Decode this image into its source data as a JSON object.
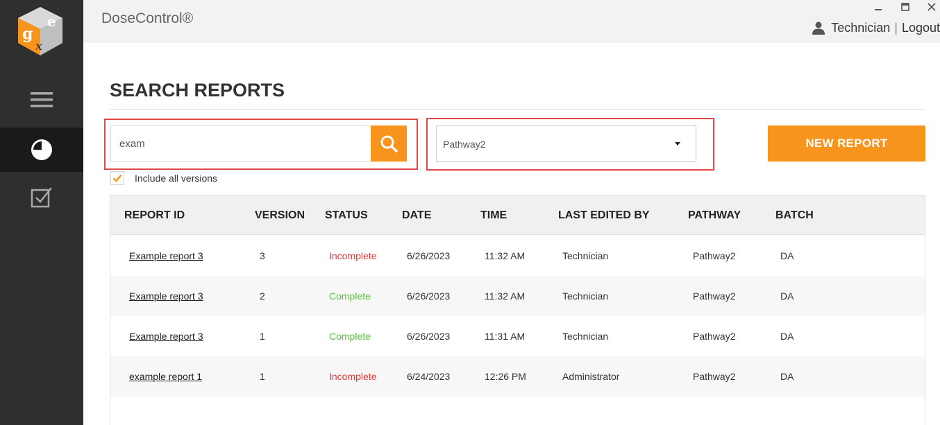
{
  "app": {
    "title": "DoseControl®"
  },
  "user": {
    "name": "Technician",
    "separator": "|",
    "logout_label": "Logout"
  },
  "page": {
    "title": "SEARCH REPORTS"
  },
  "search": {
    "value": "exam",
    "placeholder": ""
  },
  "pathway_select": {
    "selected": "Pathway2"
  },
  "new_report_label": "NEW REPORT",
  "include_versions": {
    "label": "Include all versions",
    "checked": true
  },
  "table": {
    "headers": [
      "REPORT ID",
      "VERSION",
      "STATUS",
      "DATE",
      "TIME",
      "LAST EDITED BY",
      "PATHWAY",
      "BATCH"
    ],
    "rows": [
      [
        "Example report 3",
        "3",
        "Incomplete",
        "6/26/2023",
        "11:32 AM",
        "Technician",
        "Pathway2",
        "DA"
      ],
      [
        "Example report 3",
        "2",
        "Complete",
        "6/26/2023",
        "11:32 AM",
        "Technician",
        "Pathway2",
        "DA"
      ],
      [
        "Example report 3",
        "1",
        "Complete",
        "6/26/2023",
        "11:31 AM",
        "Technician",
        "Pathway2",
        "DA"
      ],
      [
        "example report 1",
        "1",
        "Incomplete",
        "6/24/2023",
        "12:26 PM",
        "Administrator",
        "Pathway2",
        "DA"
      ]
    ]
  },
  "colors": {
    "accent": "#f7941d",
    "sidebar": "#2f2f2f",
    "status_incomplete": "#e03838",
    "status_complete": "#5cc43a",
    "highlight_border": "#e04848"
  },
  "icons": {
    "logo": "gxe-cube-logo",
    "nav": [
      "hamburger-menu-icon",
      "pie-chart-icon",
      "checkbox-icon"
    ],
    "search": "search-icon",
    "user": "user-icon",
    "window": [
      "minimize-icon",
      "maximize-icon",
      "close-icon"
    ]
  }
}
